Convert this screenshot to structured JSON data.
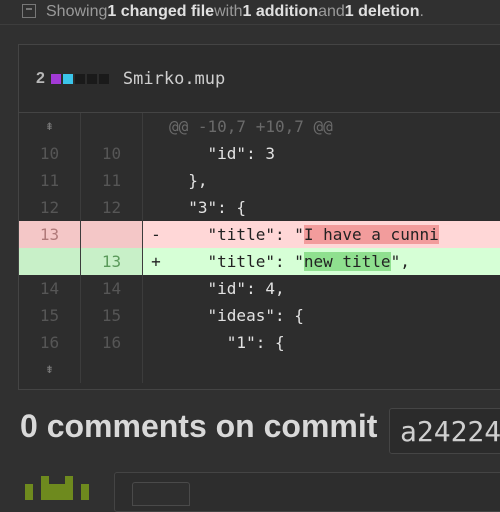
{
  "summary": {
    "prefix": "Showing ",
    "files_count": "1 changed file",
    "with": " with ",
    "additions": "1 addition",
    "and": " and ",
    "deletions": "1 deletion",
    "period": "."
  },
  "file": {
    "diffstat_number": "2",
    "diffstat_colors": [
      "#a23ad6",
      "#3bc5ea",
      "#1a1a1a",
      "#1a1a1a",
      "#1a1a1a"
    ],
    "name": "Smirko.mup"
  },
  "diff": {
    "hunk_header": "@@ -10,7 +10,7 @@",
    "lines": [
      {
        "type": "ctx",
        "old": "10",
        "new": "10",
        "sign": " ",
        "text": "    \"id\": 3"
      },
      {
        "type": "ctx",
        "old": "11",
        "new": "11",
        "sign": " ",
        "text": "  },"
      },
      {
        "type": "ctx",
        "old": "12",
        "new": "12",
        "sign": " ",
        "text": "  \"3\": {"
      },
      {
        "type": "del",
        "old": "13",
        "new": "",
        "sign": "-",
        "text_before": "    \"title\": \"",
        "text_hl": "I have a cunni"
      },
      {
        "type": "add",
        "old": "",
        "new": "13",
        "sign": "+",
        "text_before": "    \"title\": \"",
        "text_hl": "new title",
        "text_after": "\","
      },
      {
        "type": "ctx",
        "old": "14",
        "new": "14",
        "sign": " ",
        "text": "    \"id\": 4,"
      },
      {
        "type": "ctx",
        "old": "15",
        "new": "15",
        "sign": " ",
        "text": "    \"ideas\": {"
      },
      {
        "type": "ctx",
        "old": "16",
        "new": "16",
        "sign": " ",
        "text": "      \"1\": {"
      }
    ]
  },
  "comments": {
    "title": "0 comments on commit",
    "sha": "a24224"
  },
  "icons": {
    "expand": "expand-icon",
    "summary": "diff-summary-icon",
    "avatar": "identicon-avatar"
  }
}
